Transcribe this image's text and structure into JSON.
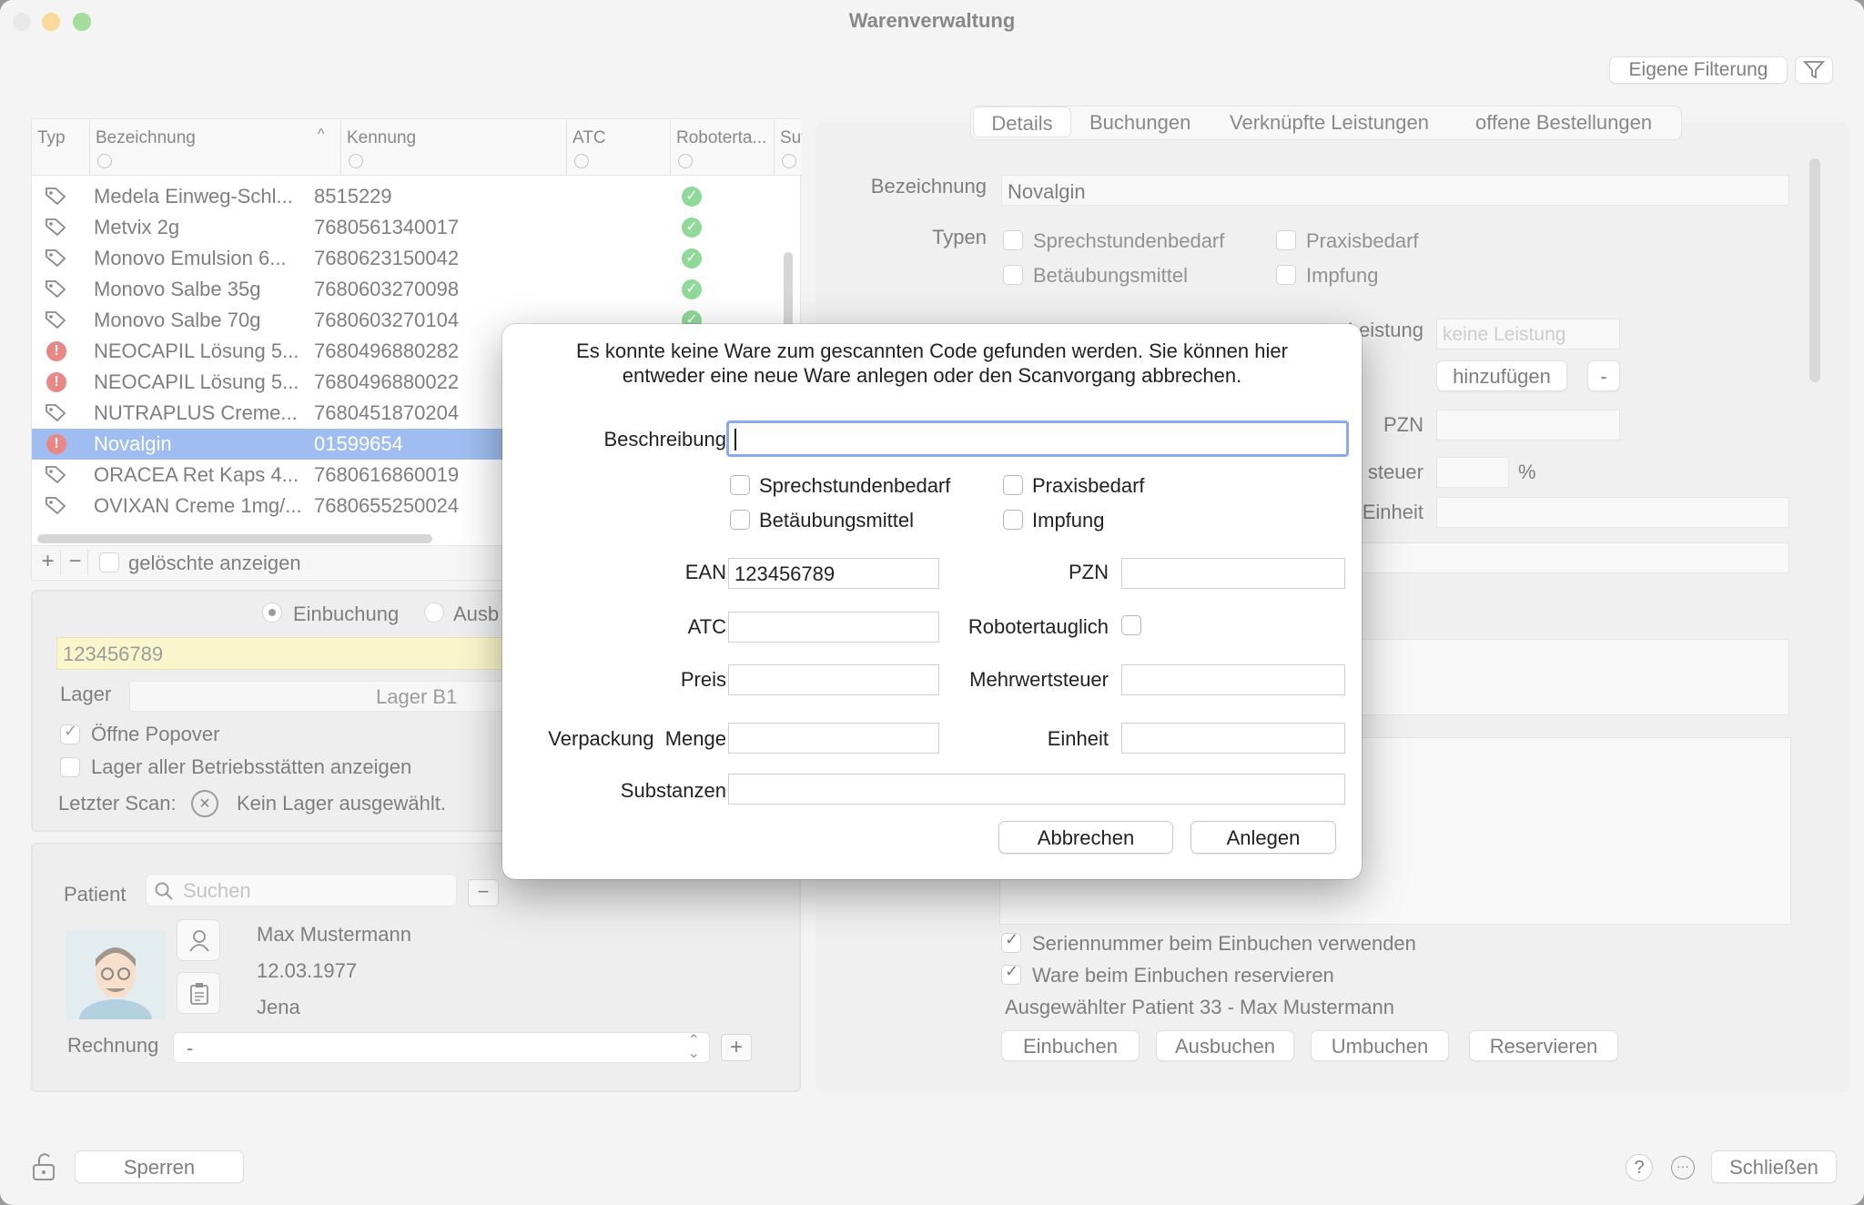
{
  "window": {
    "title": "Warenverwaltung"
  },
  "toolbar": {
    "filter_button": "Eigene Filterung"
  },
  "table": {
    "columns": [
      "Typ",
      "Bezeichnung",
      "Kennung",
      "ATC",
      "Robotertа...",
      "Sut"
    ],
    "rows": [
      {
        "icon": "tag",
        "name": "Medela Einweg-Schl...",
        "code": "8515229",
        "robot": true
      },
      {
        "icon": "tag",
        "name": "Metvix 2g",
        "code": "7680561340017",
        "robot": true
      },
      {
        "icon": "tag",
        "name": "Monovo Emulsion 6...",
        "code": "7680623150042",
        "robot": true
      },
      {
        "icon": "tag",
        "name": "Monovo Salbe 35g",
        "code": "7680603270098",
        "robot": true
      },
      {
        "icon": "tag",
        "name": "Monovo Salbe 70g",
        "code": "7680603270104",
        "robot": true
      },
      {
        "icon": "error",
        "name": "NEOCAPIL Lösung 5...",
        "code": "7680496880282",
        "robot": false
      },
      {
        "icon": "error",
        "name": "NEOCAPIL Lösung 5...",
        "code": "7680496880022",
        "robot": false
      },
      {
        "icon": "tag",
        "name": "NUTRAPLUS Creme...",
        "code": "7680451870204",
        "robot": false
      },
      {
        "icon": "error",
        "name": "Novalgin",
        "code": "01599654",
        "robot": false,
        "selected": true
      },
      {
        "icon": "tag",
        "name": "ORACEA Ret Kaps 4...",
        "code": "7680616860019",
        "robot": false
      },
      {
        "icon": "tag",
        "name": "OVIXAN Creme 1mg/...",
        "code": "7680655250024",
        "robot": false
      }
    ],
    "add_symbol": "+",
    "remove_symbol": "−",
    "show_deleted_label": "gelöschte anzeigen"
  },
  "scan": {
    "radio_in": "Einbuchung",
    "radio_out": "Ausb",
    "scan_value": "123456789",
    "lager_label": "Lager",
    "lager_value": "Lager B1",
    "open_popover": "Öffne Popover",
    "all_sites": "Lager aller Betriebsstätten anzeigen",
    "last_scan_label": "Letzter Scan:",
    "last_scan_value": "Kein Lager ausgewählt."
  },
  "patient": {
    "label": "Patient",
    "search_placeholder": "Suchen",
    "name": "Max Mustermann",
    "dob": "12.03.1977",
    "city": "Jena",
    "rechnung_label": "Rechnung",
    "rechnung_value": "-"
  },
  "tabs": [
    "Details",
    "Buchungen",
    "Verknüpfte Leistungen",
    "offene Bestellungen"
  ],
  "details": {
    "bezeichnung_label": "Bezeichnung",
    "bezeichnung_value": "Novalgin",
    "typen_label": "Typen",
    "types": [
      "Sprechstundenbedarf",
      "Praxisbedarf",
      "Betäubungsmittel",
      "Impfung"
    ],
    "leistung_label": "Leistung",
    "leistung_placeholder": "keine Leistung",
    "add_button": "hinzufügen",
    "minus_button": "-",
    "pzn_label": "PZN",
    "steuer_label": "steuer",
    "percent": "%",
    "einheit_label": "Einheit",
    "serial_check": "Seriennummer beim Einbuchen verwenden",
    "reserve_check": "Ware beim Einbuchen reservieren",
    "selected_patient": "Ausgewählter Patient 33 - Max Mustermann",
    "buttons": [
      "Einbuchen",
      "Ausbuchen",
      "Umbuchen",
      "Reservieren"
    ]
  },
  "bottom": {
    "lock_button": "Sperren",
    "help": "?",
    "close_button": "Schließen"
  },
  "dialog": {
    "message_line1": "Es konnte keine Ware zum gescannten Code gefunden werden. Sie können hier",
    "message_line2": "entweder eine neue Ware anlegen oder den Scanvorgang abbrechen.",
    "beschreibung_label": "Beschreibung",
    "beschreibung_value": "",
    "types": [
      "Sprechstundenbedarf",
      "Praxisbedarf",
      "Betäubungsmittel",
      "Impfung"
    ],
    "ean_label": "EAN",
    "ean_value": "123456789",
    "pzn_label": "PZN",
    "atc_label": "ATC",
    "robot_label": "Robotertauglich",
    "preis_label": "Preis",
    "mwst_label": "Mehrwertsteuer",
    "verpackung_label": "Verpackung  Menge",
    "einheit_label": "Einheit",
    "substanzen_label": "Substanzen",
    "cancel_button": "Abbrechen",
    "create_button": "Anlegen"
  },
  "colors": {
    "selection": "#5b8ee6",
    "focus": "#8aaaf0",
    "ok_green": "#3fbf50",
    "error_red": "#d9312b"
  }
}
